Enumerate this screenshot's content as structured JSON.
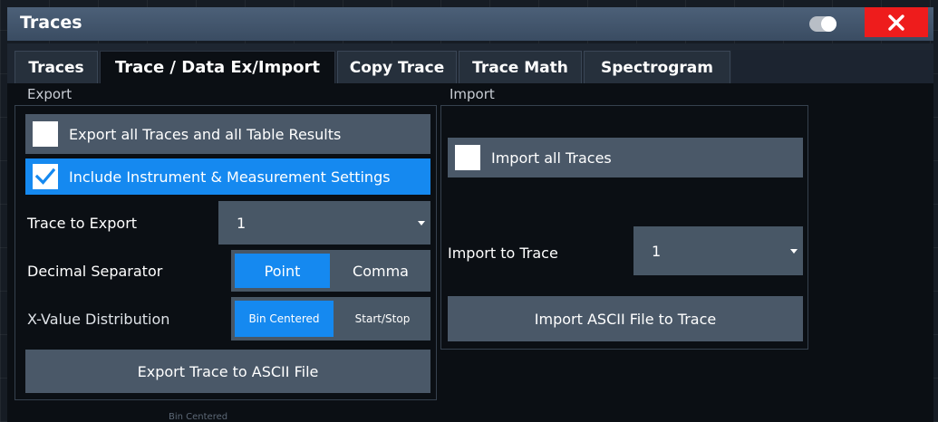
{
  "dialog": {
    "title": "Traces"
  },
  "tabs": [
    {
      "label": "Traces"
    },
    {
      "label": "Trace / Data Ex/Import",
      "active": true
    },
    {
      "label": "Copy Trace"
    },
    {
      "label": "Trace Math"
    },
    {
      "label": "Spectrogram"
    }
  ],
  "export": {
    "section_label": "Export",
    "export_all": {
      "label": "Export all Traces and all Table Results",
      "checked": false
    },
    "include_settings": {
      "label": "Include Instrument & Measurement Settings",
      "checked": true
    },
    "trace_to_export": {
      "label": "Trace to Export",
      "value": "1"
    },
    "decimal_separator": {
      "label": "Decimal Separator",
      "options": [
        "Point",
        "Comma"
      ],
      "selected": "Point"
    },
    "x_value_distribution": {
      "label": "X-Value Distribution",
      "options": [
        "Bin Centered",
        "Start/Stop"
      ],
      "selected": "Bin Centered"
    },
    "export_button": "Export Trace to ASCII File"
  },
  "import": {
    "section_label": "Import",
    "import_all": {
      "label": "Import all Traces",
      "checked": false
    },
    "import_to_trace": {
      "label": "Import to Trace",
      "value": "1"
    },
    "import_button": "Import ASCII File to Trace"
  },
  "background": {
    "ghost_label": "Bin Centered"
  },
  "colors": {
    "accent": "#1589f0",
    "close": "#ee1c1c",
    "titlebar": "#3a4c62",
    "control": "#4a5868",
    "panel": "#0b0f14"
  }
}
